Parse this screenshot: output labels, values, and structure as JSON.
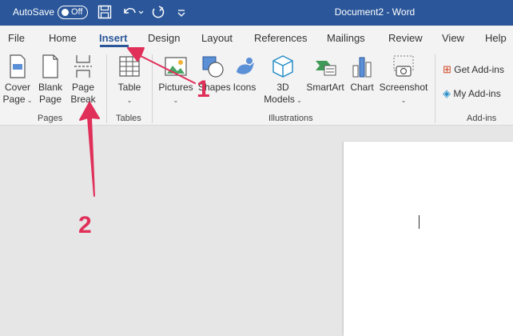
{
  "titlebar": {
    "autosave_label": "AutoSave",
    "toggle_state": "Off",
    "document_title": "Document2 - Word",
    "accent": "#2b579a"
  },
  "tabs": [
    {
      "label": "File"
    },
    {
      "label": "Home"
    },
    {
      "label": "Insert",
      "active": true
    },
    {
      "label": "Design"
    },
    {
      "label": "Layout"
    },
    {
      "label": "References"
    },
    {
      "label": "Mailings"
    },
    {
      "label": "Review"
    },
    {
      "label": "View"
    },
    {
      "label": "Help"
    }
  ],
  "ribbon": {
    "pages": {
      "group_label": "Pages",
      "cover_page": {
        "line1": "Cover",
        "line2": "Page"
      },
      "blank_page": {
        "line1": "Blank",
        "line2": "Page"
      },
      "page_break": {
        "line1": "Page",
        "line2": "Break"
      }
    },
    "tables": {
      "group_label": "Tables",
      "table": "Table"
    },
    "illustrations": {
      "group_label": "Illustrations",
      "pictures": "Pictures",
      "shapes": "Shapes",
      "icons": "Icons",
      "models": {
        "line1": "3D",
        "line2": "Models"
      },
      "smartart": "SmartArt",
      "chart": "Chart",
      "screenshot": "Screenshot"
    },
    "addins": {
      "group_label": "Add-ins",
      "get_addins": "Get Add-ins",
      "my_addins": "My Add-ins"
    }
  },
  "annotations": {
    "step1": "1",
    "step2": "2",
    "color": "#e0305a"
  }
}
